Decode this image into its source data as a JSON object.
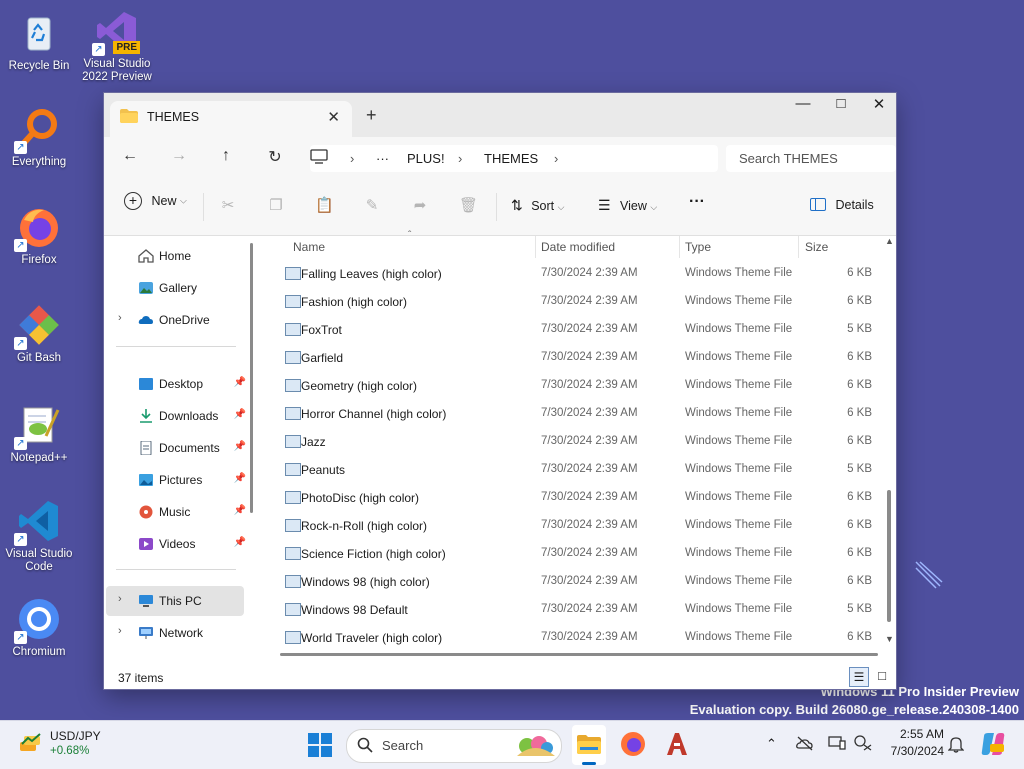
{
  "desktop": {
    "icons": [
      {
        "label": "Recycle Bin",
        "icon": "recycle-bin-icon"
      },
      {
        "label": "Visual Studio 2022 Preview",
        "icon": "visual-studio-preview-icon",
        "badge": "PRE"
      },
      {
        "label": "Everything",
        "icon": "everything-search-icon"
      },
      {
        "label": "Firefox",
        "icon": "firefox-icon"
      },
      {
        "label": "Git Bash",
        "icon": "git-bash-icon"
      },
      {
        "label": "Notepad++",
        "icon": "notepadpp-icon"
      },
      {
        "label": "Visual Studio Code",
        "icon": "vscode-icon"
      },
      {
        "label": "Chromium",
        "icon": "chromium-icon"
      }
    ],
    "watermark_line1": "Windows 11 Pro Insider Preview",
    "watermark_line2": "Evaluation copy. Build 26080.ge_release.240308-1400"
  },
  "explorer": {
    "tab_title": "THEMES",
    "breadcrumb": [
      "PLUS!",
      "THEMES"
    ],
    "breadcrumb_overflow": "···",
    "search_placeholder": "Search THEMES",
    "toolbar": {
      "new_label": "New",
      "sort_label": "Sort",
      "view_label": "View",
      "more_label": "···",
      "details_label": "Details"
    },
    "nav": {
      "top": [
        {
          "label": "Home",
          "icon": "home-icon"
        },
        {
          "label": "Gallery",
          "icon": "gallery-icon"
        },
        {
          "label": "OneDrive",
          "icon": "onedrive-icon"
        }
      ],
      "quick": [
        {
          "label": "Desktop",
          "icon": "desktop-icon"
        },
        {
          "label": "Downloads",
          "icon": "downloads-icon"
        },
        {
          "label": "Documents",
          "icon": "documents-icon"
        },
        {
          "label": "Pictures",
          "icon": "pictures-icon"
        },
        {
          "label": "Music",
          "icon": "music-icon"
        },
        {
          "label": "Videos",
          "icon": "videos-icon"
        }
      ],
      "bottom": [
        {
          "label": "This PC",
          "icon": "this-pc-icon"
        },
        {
          "label": "Network",
          "icon": "network-icon"
        }
      ]
    },
    "columns": {
      "name": "Name",
      "date": "Date modified",
      "type": "Type",
      "size": "Size"
    },
    "files": [
      {
        "name": "Falling Leaves (high color)",
        "date": "7/30/2024 2:39 AM",
        "type": "Windows Theme File",
        "size": "6 KB"
      },
      {
        "name": "Fashion (high color)",
        "date": "7/30/2024 2:39 AM",
        "type": "Windows Theme File",
        "size": "6 KB"
      },
      {
        "name": "FoxTrot",
        "date": "7/30/2024 2:39 AM",
        "type": "Windows Theme File",
        "size": "5 KB"
      },
      {
        "name": "Garfield",
        "date": "7/30/2024 2:39 AM",
        "type": "Windows Theme File",
        "size": "6 KB"
      },
      {
        "name": "Geometry (high color)",
        "date": "7/30/2024 2:39 AM",
        "type": "Windows Theme File",
        "size": "6 KB"
      },
      {
        "name": "Horror Channel (high color)",
        "date": "7/30/2024 2:39 AM",
        "type": "Windows Theme File",
        "size": "6 KB"
      },
      {
        "name": "Jazz",
        "date": "7/30/2024 2:39 AM",
        "type": "Windows Theme File",
        "size": "6 KB"
      },
      {
        "name": "Peanuts",
        "date": "7/30/2024 2:39 AM",
        "type": "Windows Theme File",
        "size": "5 KB"
      },
      {
        "name": "PhotoDisc (high color)",
        "date": "7/30/2024 2:39 AM",
        "type": "Windows Theme File",
        "size": "6 KB"
      },
      {
        "name": "Rock-n-Roll (high color)",
        "date": "7/30/2024 2:39 AM",
        "type": "Windows Theme File",
        "size": "6 KB"
      },
      {
        "name": "Science Fiction (high color)",
        "date": "7/30/2024 2:39 AM",
        "type": "Windows Theme File",
        "size": "6 KB"
      },
      {
        "name": "Windows 98 (high color)",
        "date": "7/30/2024 2:39 AM",
        "type": "Windows Theme File",
        "size": "6 KB"
      },
      {
        "name": "Windows 98 Default",
        "date": "7/30/2024 2:39 AM",
        "type": "Windows Theme File",
        "size": "5 KB"
      },
      {
        "name": "World Traveler (high color)",
        "date": "7/30/2024 2:39 AM",
        "type": "Windows Theme File",
        "size": "6 KB"
      }
    ],
    "status_count": "37 items"
  },
  "taskbar": {
    "widget_title": "USD/JPY",
    "widget_value": "+0.68%",
    "search_label": "Search",
    "time": "2:55 AM",
    "date": "7/30/2024"
  },
  "colors": {
    "desktop_bg": "#4e4f9e",
    "accent": "#0067c0",
    "widget_up": "#1a7f37"
  }
}
